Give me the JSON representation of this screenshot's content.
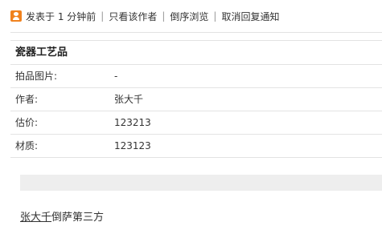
{
  "post_bar": {
    "posted_at": "发表于 1 分钟前",
    "separator": "|",
    "links": [
      "只看该作者",
      "倒序浏览",
      "取消回复通知"
    ]
  },
  "item_table": {
    "title": "瓷器工艺品",
    "rows": [
      {
        "label": "拍品图片:",
        "value": "-"
      },
      {
        "label": "作者:",
        "value": "张大千"
      },
      {
        "label": "估价:",
        "value": "123213"
      },
      {
        "label": "材质:",
        "value": "123123"
      }
    ]
  },
  "footer": {
    "author_link": "张大千",
    "text": "倒萨第三方"
  },
  "icons": {
    "user": "user-avatar-icon"
  }
}
